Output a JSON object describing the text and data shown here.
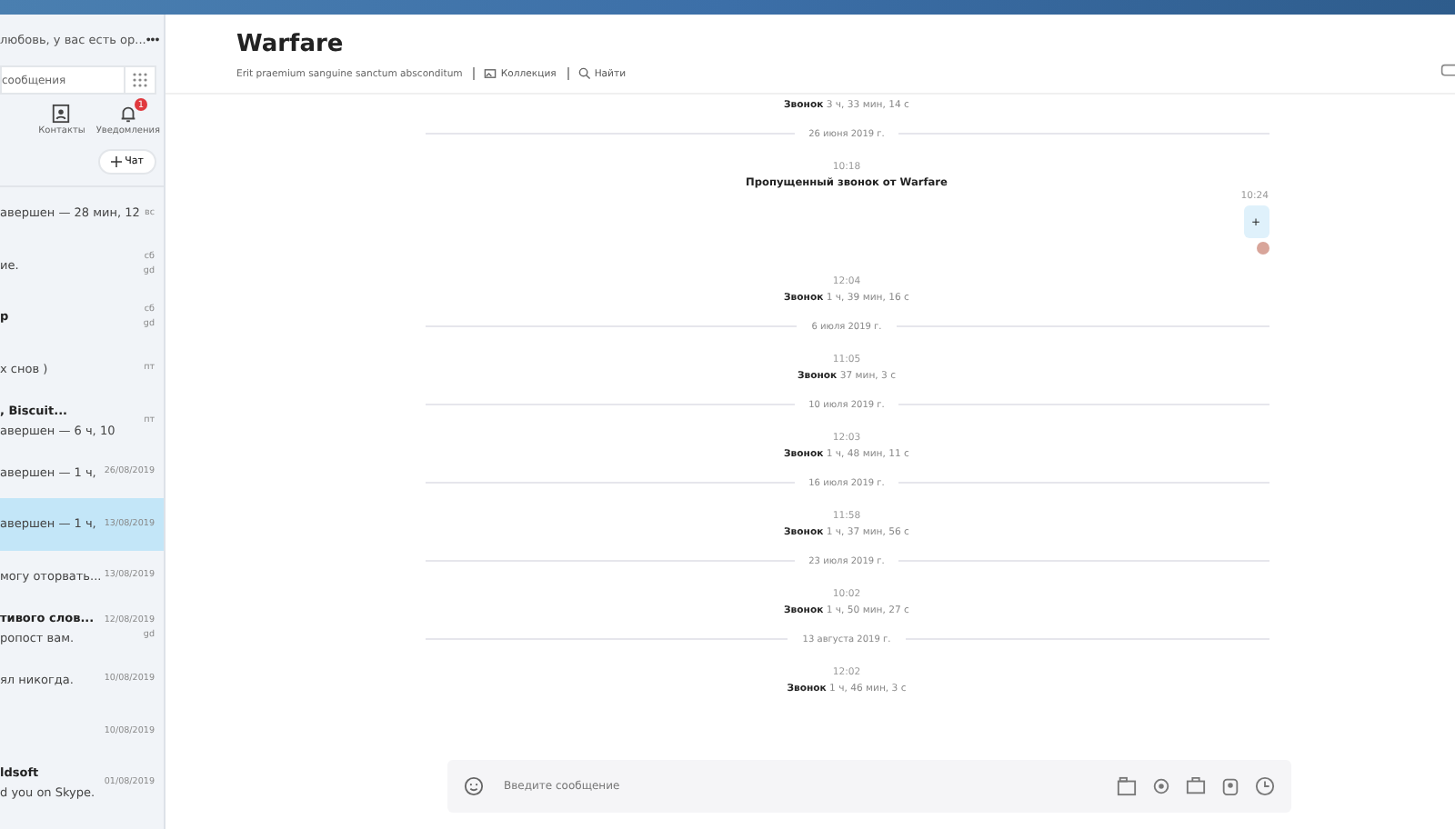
{
  "sidebar": {
    "status_text": "любовь, у вас есть ор...",
    "more": "•••",
    "search": {
      "placeholder": "сообщения"
    },
    "nav": [
      {
        "kind": "contacts",
        "label": "Контакты"
      },
      {
        "kind": "notifications",
        "label": "Уведомления",
        "badge": "1"
      }
    ],
    "new_chat_button": "Чат",
    "chats": [
      {
        "preview": "авершен — 28 мин, 12",
        "time": "вс",
        "selected": false
      },
      {
        "preview": "ие.",
        "time": "сб",
        "meta": "gd",
        "selected": false
      },
      {
        "title": "р",
        "time": "сб",
        "meta": "gd",
        "selected": false
      },
      {
        "preview": "х снов )",
        "time": "пт",
        "selected": false
      },
      {
        "title": ", Biscuit...",
        "preview": "авершен — 6 ч, 10",
        "time": "пт",
        "selected": false
      },
      {
        "preview": "авершен — 1 ч,",
        "time": "26/08/2019",
        "selected": false
      },
      {
        "preview": "авершен — 1 ч,",
        "time": "13/08/2019",
        "selected": true
      },
      {
        "preview": "могу оторвать...",
        "time": "13/08/2019",
        "selected": false
      },
      {
        "title": "тивого слов...",
        "preview": "ропост вам.",
        "time": "12/08/2019",
        "meta": "gd",
        "selected": false
      },
      {
        "preview": "ял никогда.",
        "time": "10/08/2019",
        "selected": false
      },
      {
        "time": "10/08/2019",
        "selected": false
      },
      {
        "title": "ldsoft",
        "preview": "d you on Skype.",
        "time": "01/08/2019",
        "selected": false
      }
    ]
  },
  "conversation": {
    "title": "Warfare",
    "subtitle": "Erit praemium sanguine sanctum absconditum",
    "links": [
      {
        "kind": "gallery",
        "label": "Коллекция"
      },
      {
        "kind": "search",
        "label": "Найти"
      }
    ],
    "events": [
      {
        "kind": "call",
        "label": "Звонок",
        "duration": "3 ч, 33 мин, 14 с"
      },
      {
        "kind": "date",
        "text": "26 июня 2019 г."
      },
      {
        "kind": "missed",
        "time": "10:18",
        "text": "Пропущенный звонок от Warfare"
      },
      {
        "kind": "outgoing",
        "time": "10:24",
        "text": "+"
      },
      {
        "kind": "call",
        "time": "12:04",
        "label": "Звонок",
        "duration": "1 ч, 39 мин, 16 с"
      },
      {
        "kind": "date",
        "text": "6 июля 2019 г."
      },
      {
        "kind": "call",
        "time": "11:05",
        "label": "Звонок",
        "duration": "37 мин, 3 с"
      },
      {
        "kind": "date",
        "text": "10 июля 2019 г."
      },
      {
        "kind": "call",
        "time": "12:03",
        "label": "Звонок",
        "duration": "1 ч, 48 мин, 11 с"
      },
      {
        "kind": "date",
        "text": "16 июля 2019 г."
      },
      {
        "kind": "call",
        "time": "11:58",
        "label": "Звонок",
        "duration": "1 ч, 37 мин, 56 с"
      },
      {
        "kind": "date",
        "text": "23 июля 2019 г."
      },
      {
        "kind": "call",
        "time": "10:02",
        "label": "Звонок",
        "duration": "1 ч, 50 мин, 27 с"
      },
      {
        "kind": "date",
        "text": "13 августа 2019 г."
      },
      {
        "kind": "call",
        "time": "12:02",
        "label": "Звонок",
        "duration": "1 ч, 46 мин, 3 с"
      }
    ],
    "composer": {
      "placeholder": "Введите сообщение"
    }
  }
}
